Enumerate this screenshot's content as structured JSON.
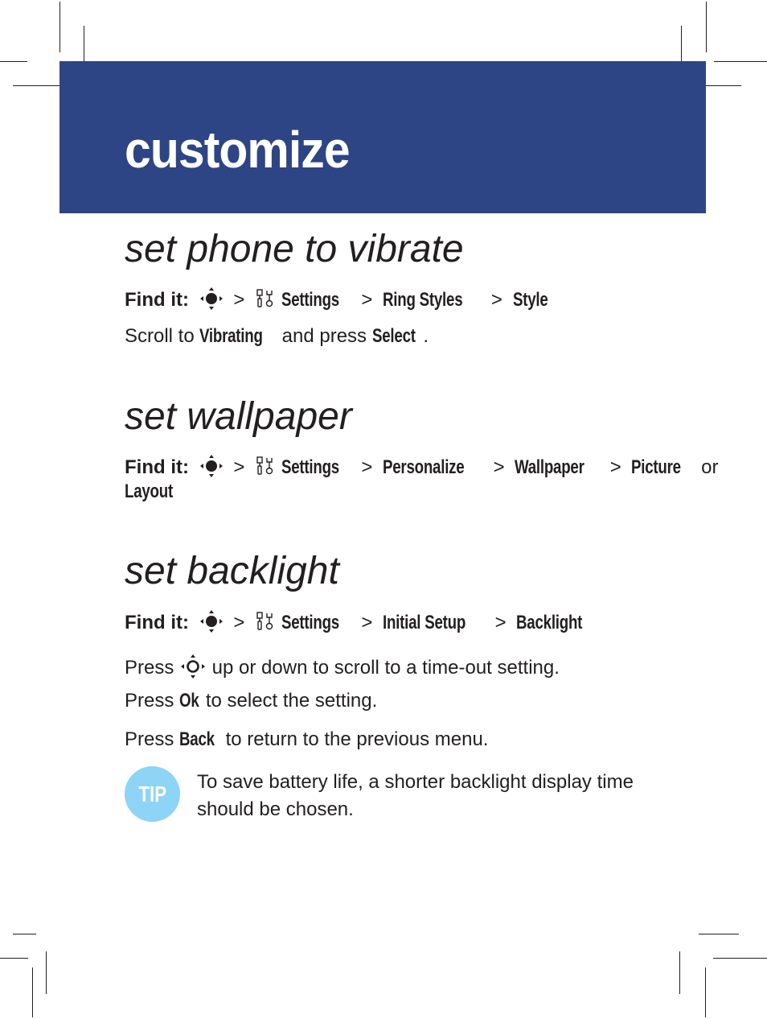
{
  "page": {
    "title": "customize",
    "colors": {
      "header_bg": "#2d4585",
      "tip_bg": "#8dd4f6",
      "text": "#231f20"
    }
  },
  "sections": [
    {
      "title": "set phone to vibrate",
      "find_it": {
        "label": "Find it:",
        "icons": [
          "nav-key-icon",
          "settings-tools-icon"
        ],
        "path": [
          "Settings",
          "Ring Styles",
          "Style"
        ],
        "separator": ">"
      },
      "steps": [
        {
          "prefix": "Scroll to ",
          "key": "Vibrating",
          "middle": " and press ",
          "key2": "Select",
          "suffix": "."
        }
      ]
    },
    {
      "title": "set wallpaper",
      "find_it": {
        "label": "Find it:",
        "icons": [
          "nav-key-icon",
          "settings-tools-icon"
        ],
        "path": [
          "Settings",
          "Personalize",
          "Wallpaper",
          "Picture"
        ],
        "or_word": "or",
        "alt": "Layout",
        "separator": ">"
      }
    },
    {
      "title": "set backlight",
      "find_it": {
        "label": "Find it:",
        "icons": [
          "nav-key-icon",
          "settings-tools-icon"
        ],
        "path": [
          "Settings",
          "Initial Setup",
          "Backlight"
        ],
        "separator": ">"
      },
      "steps": [
        {
          "prefix": "Press ",
          "icon": "nav-ring-icon",
          "suffix": " up or down to scroll to a time-out setting."
        },
        {
          "prefix": "Press ",
          "key": "Ok",
          "suffix": " to select the setting."
        },
        {
          "prefix": "Press ",
          "key": "Back",
          "suffix": " to return to the previous menu."
        }
      ],
      "tip": {
        "badge": "TIP",
        "text": "To save battery life, a shorter backlight display time should be chosen."
      }
    }
  ]
}
